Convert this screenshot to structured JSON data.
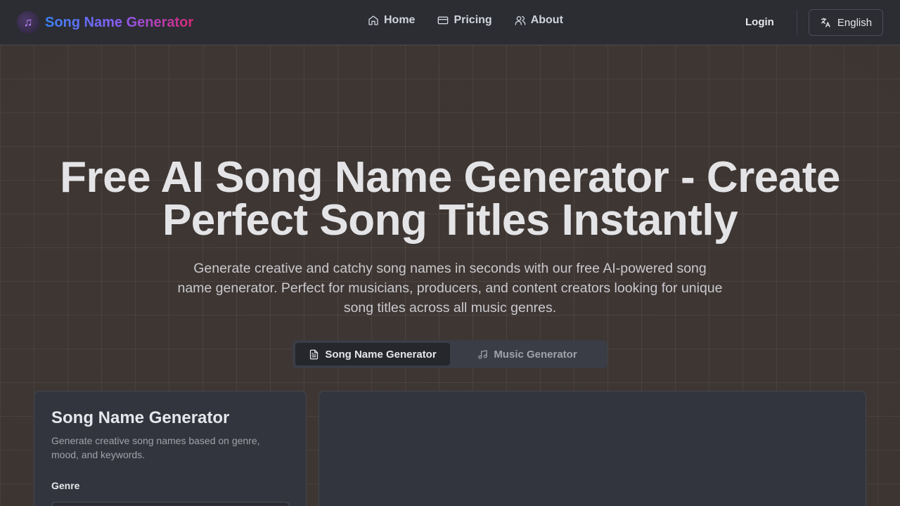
{
  "header": {
    "app_name": "Song Name Generator",
    "nav": [
      {
        "label": "Home",
        "icon": "home-icon"
      },
      {
        "label": "Pricing",
        "icon": "card-icon"
      },
      {
        "label": "About",
        "icon": "users-icon"
      }
    ],
    "login_label": "Login",
    "language_label": "English"
  },
  "hero": {
    "title_line1": "Free AI Song Name Generator - Create",
    "title_line2": "Perfect Song Titles Instantly",
    "subtitle": "Generate creative and catchy song names in seconds with our free AI-powered song name generator. Perfect for musicians, producers, and content creators looking for unique song titles across all music genres."
  },
  "tabs": [
    {
      "label": "Song Name Generator",
      "icon": "file-text-icon",
      "active": true
    },
    {
      "label": "Music Generator",
      "icon": "music-note-icon",
      "active": false
    }
  ],
  "form_card": {
    "title": "Song Name Generator",
    "description": "Generate creative song names based on genre, mood, and keywords.",
    "genre_label": "Genre"
  },
  "colors": {
    "brand_gradient": [
      "#3b82f6",
      "#8b5cf6",
      "#db2777"
    ],
    "header_bg": "#2b2d33",
    "card_bg": "#32353d"
  }
}
